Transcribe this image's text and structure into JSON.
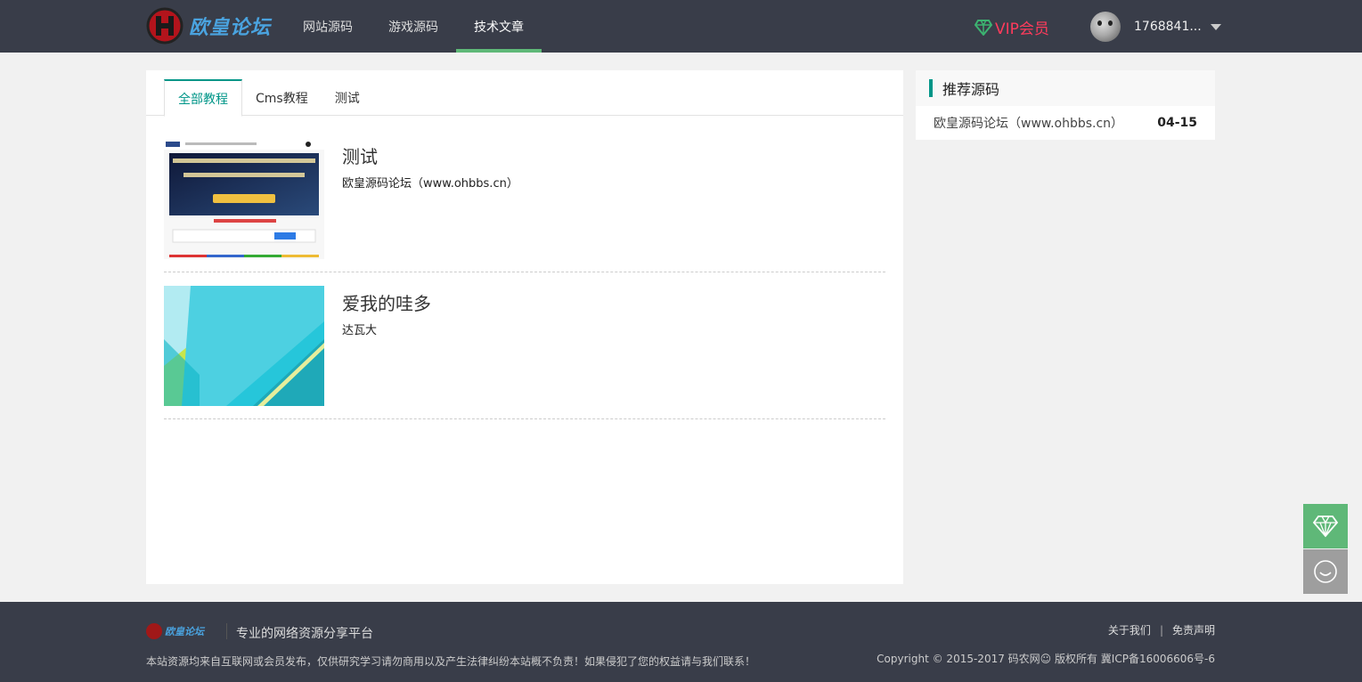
{
  "header": {
    "logo_text": "欧皇论坛",
    "nav": [
      {
        "label": "网站源码",
        "active": false
      },
      {
        "label": "游戏源码",
        "active": false
      },
      {
        "label": "技术文章",
        "active": true
      }
    ],
    "vip_label": "VIP会员",
    "username": "1768841..."
  },
  "tabs": [
    {
      "label": "全部教程",
      "active": true
    },
    {
      "label": "Cms教程",
      "active": false
    },
    {
      "label": "测试",
      "active": false
    }
  ],
  "articles": [
    {
      "title": "测试",
      "desc": "欧皇源码论坛（www.ohbbs.cn）",
      "thumb_icon": "website-screenshot-thumbnail"
    },
    {
      "title": "爱我的哇多",
      "desc": "达瓦大",
      "thumb_icon": "material-abstract-thumbnail"
    }
  ],
  "sidebar": {
    "title": "推荐源码",
    "items": [
      {
        "name": "欧皇源码论坛（www.ohbbs.cn）",
        "date": "04-15"
      }
    ]
  },
  "footer": {
    "logo_text": "欧皇论坛",
    "slogan": "专业的网络资源分享平台",
    "notice": "本站资源均来自互联网或会员发布，仅供研究学习请勿商用以及产生法律纠纷本站概不负责！如果侵犯了您的权益请与我们联系！",
    "links": [
      "关于我们",
      "免责声明"
    ],
    "copyright": "Copyright © 2015-2017 码农网☺ 版权所有 冀ICP备16006606号-6"
  },
  "colors": {
    "topbar": "#393d49",
    "accent_green": "#5fb878",
    "teal": "#009688",
    "vip_red": "#ff3b5c"
  }
}
